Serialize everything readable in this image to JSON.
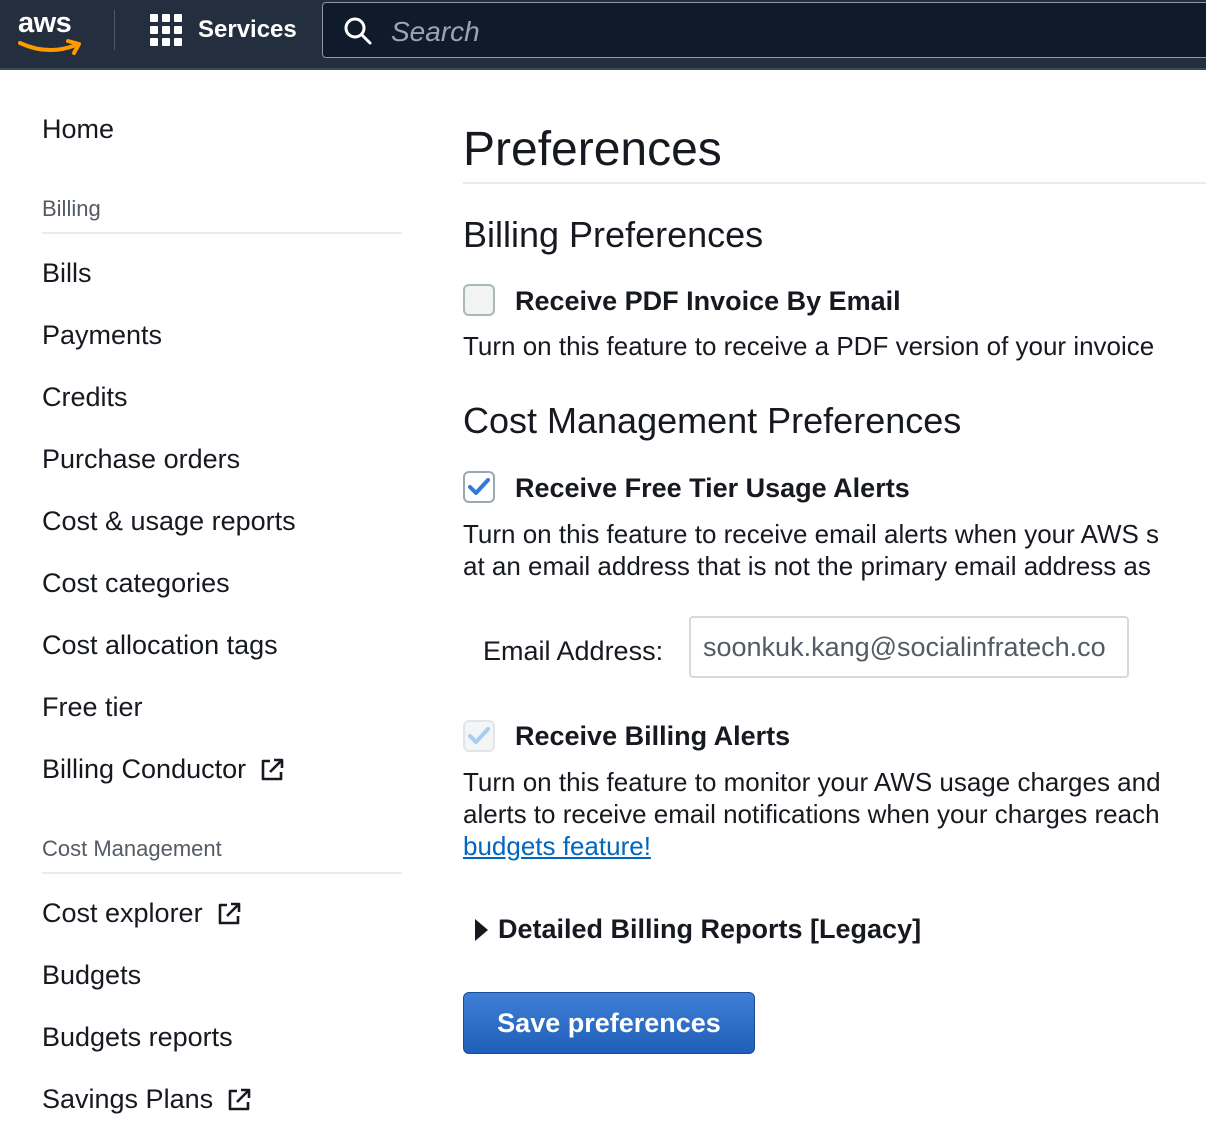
{
  "topnav": {
    "logo_text": "aws",
    "services_label": "Services",
    "search_placeholder": "Search"
  },
  "sidebar": {
    "home": "Home",
    "billing_section": "Billing",
    "billing_items": [
      "Bills",
      "Payments",
      "Credits",
      "Purchase orders",
      "Cost & usage reports",
      "Cost categories",
      "Cost allocation tags",
      "Free tier",
      "Billing Conductor"
    ],
    "cost_section": "Cost Management",
    "cost_items": [
      "Cost explorer",
      "Budgets",
      "Budgets reports",
      "Savings Plans"
    ]
  },
  "main": {
    "page_title": "Preferences",
    "billing_heading": "Billing Preferences",
    "pdf_invoice": {
      "label": "Receive PDF Invoice By Email",
      "checked": false,
      "description": "Turn on this feature to receive a PDF version of your invoice"
    },
    "cost_heading": "Cost Management Preferences",
    "free_tier": {
      "label": "Receive Free Tier Usage Alerts",
      "checked": true,
      "description_line1": "Turn on this feature to receive email alerts when your AWS s",
      "description_line2": "at an email address that is not the primary email address as"
    },
    "email": {
      "label": "Email Address:",
      "value": "soonkuk.kang@socialinfratech.co"
    },
    "billing_alerts": {
      "label": "Receive Billing Alerts",
      "checked": true,
      "disabled": true,
      "description_line1": "Turn on this feature to monitor your AWS usage charges and",
      "description_line2": "alerts to receive email notifications when your charges reach",
      "link_text": "budgets feature!"
    },
    "detailed_reports": "Detailed Billing Reports [Legacy]",
    "save_button": "Save preferences"
  },
  "colors": {
    "nav_bg": "#232f3e",
    "link": "#0066c0",
    "primary_button": "#2a6ac8",
    "checkmark": "#2f7ad8"
  }
}
